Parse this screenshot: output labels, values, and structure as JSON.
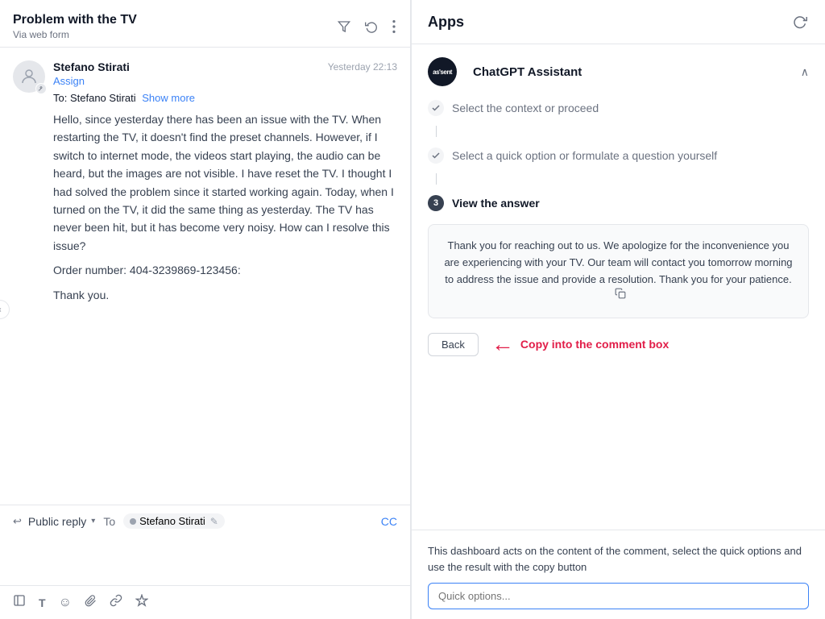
{
  "left": {
    "ticket": {
      "title": "Problem with the TV",
      "source": "Via web form"
    },
    "icons": {
      "filter": "▽",
      "history": "↺",
      "more": "⋮"
    },
    "message": {
      "sender": "Stefano Stirati",
      "time": "Yesterday 22:13",
      "assign_label": "Assign",
      "to_label": "To:",
      "to_name": "Stefano Stirati",
      "show_more": "Show more",
      "body_paragraphs": [
        "Hello, since yesterday there has been an issue with the TV. When restarting the TV, it doesn't find the preset channels. However, if I switch to internet mode, the videos start playing, the audio can be heard, but the images are not visible. I have reset the TV. I thought I had solved the problem since it started working again. Today, when I turned on the TV, it did the same thing as yesterday. The TV has never been hit, but it has become very noisy. How can I resolve this issue?",
        "Order number: 404-3239869-123456:",
        "Thank you."
      ]
    },
    "reply_bar": {
      "type_label": "Public reply",
      "to_label": "To",
      "recipient": "Stefano Stirati",
      "cc_label": "CC"
    },
    "toolbar": {
      "icons": [
        "⬒",
        "T",
        "☺",
        "⌀",
        "⚭",
        "✦"
      ]
    }
  },
  "right": {
    "header": {
      "title": "Apps",
      "refresh_icon": "↻"
    },
    "chatgpt": {
      "logo_text": "as'sent",
      "name": "ChatGPT Assistant"
    },
    "steps": [
      {
        "id": 1,
        "label": "Select the context or proceed",
        "done": true
      },
      {
        "id": 2,
        "label": "Select a quick option or formulate a question yourself",
        "done": true
      },
      {
        "id": 3,
        "label": "View the answer",
        "active": true
      }
    ],
    "answer": {
      "text": "Thank you for reaching out to us. We apologize for the inconvenience you are experiencing with your TV. Our team will contact you tomorrow morning to address the issue and provide a resolution. Thank you for your patience."
    },
    "back_btn": "Back",
    "callout_text": "Copy into the comment box",
    "bottom_description": "This dashboard acts on the content of the comment, select the quick options and use the result with the copy button",
    "quick_option_placeholder": "Quick options..."
  }
}
